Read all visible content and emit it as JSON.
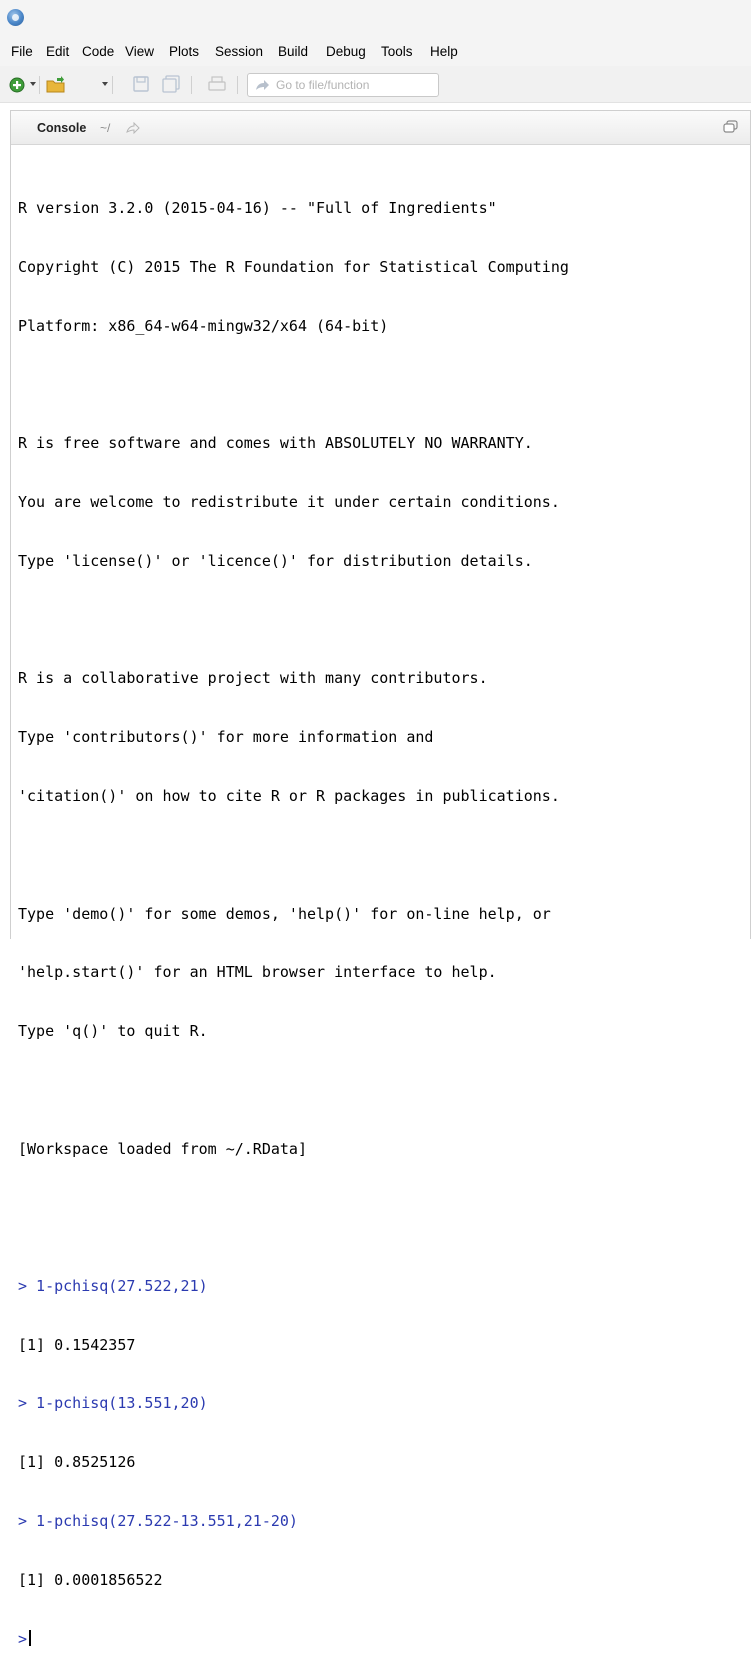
{
  "menu": [
    "File",
    "Edit",
    "Code",
    "View",
    "Plots",
    "Session",
    "Build",
    "Debug",
    "Tools",
    "Help"
  ],
  "toolbar": {
    "goto_placeholder": "Go to file/function"
  },
  "pane": {
    "title": "Console",
    "path": "~/"
  },
  "console": {
    "banner": [
      "R version 3.2.0 (2015-04-16) -- \"Full of Ingredients\"",
      "Copyright (C) 2015 The R Foundation for Statistical Computing",
      "Platform: x86_64-w64-mingw32/x64 (64-bit)",
      "",
      "R is free software and comes with ABSOLUTELY NO WARRANTY.",
      "You are welcome to redistribute it under certain conditions.",
      "Type 'license()' or 'licence()' for distribution details.",
      "",
      "R is a collaborative project with many contributors.",
      "Type 'contributors()' for more information and",
      "'citation()' on how to cite R or R packages in publications.",
      "",
      "Type 'demo()' for some demos, 'help()' for on-line help, or",
      "'help.start()' for an HTML browser interface to help.",
      "Type 'q()' to quit R.",
      "",
      "[Workspace loaded from ~/.RData]",
      ""
    ],
    "commands": [
      {
        "input": "> 1-pchisq(27.522,21)",
        "output": "[1] 0.1542357"
      },
      {
        "input": "> 1-pchisq(13.551,20)",
        "output": "[1] 0.8525126"
      },
      {
        "input": "> 1-pchisq(27.522-13.551,21-20)",
        "output": "[1] 0.0001856522"
      }
    ],
    "prompt": ">"
  },
  "colors": {
    "command": "#2b3ab0",
    "output": "#000000"
  }
}
